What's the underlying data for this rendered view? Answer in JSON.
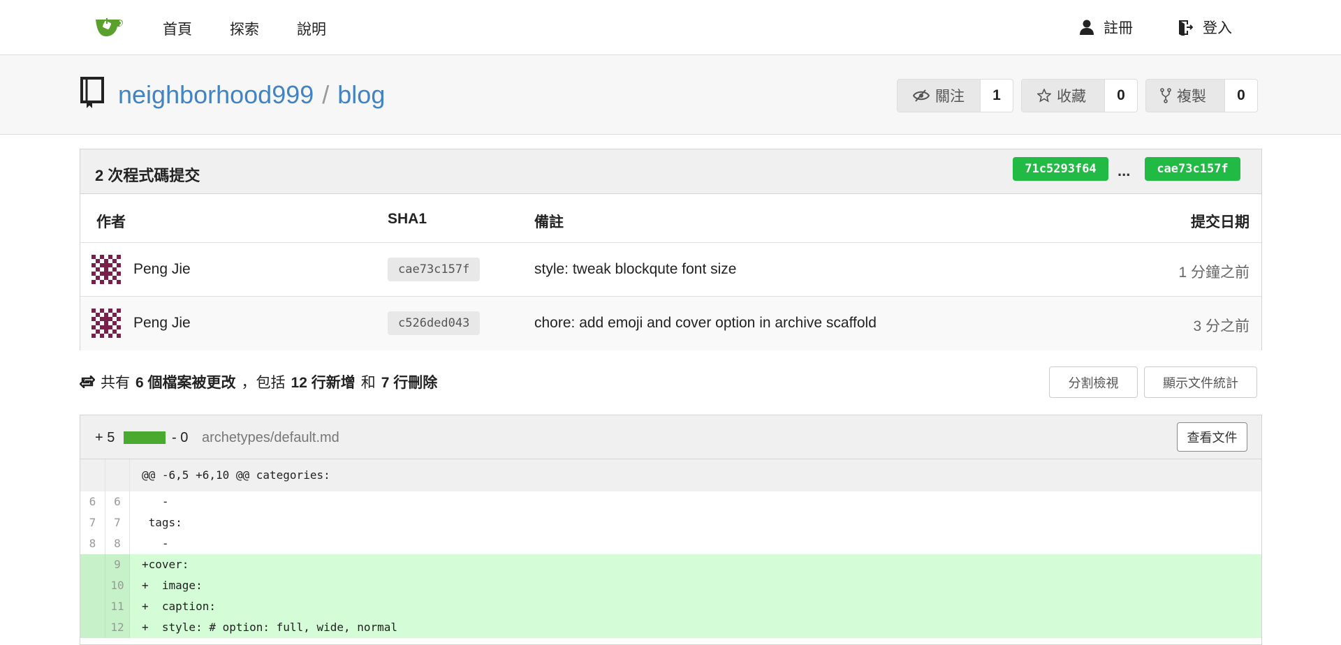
{
  "nav": {
    "links": [
      "首頁",
      "探索",
      "說明"
    ],
    "register": "註冊",
    "login": "登入"
  },
  "repo": {
    "owner": "neighborhood999",
    "separator": "/",
    "name": "blog",
    "watch": {
      "label": "關注",
      "count": "1"
    },
    "star": {
      "label": "收藏",
      "count": "0"
    },
    "fork": {
      "label": "複製",
      "count": "0"
    }
  },
  "commits": {
    "title": "2 次程式碼提交",
    "from_sha": "71c5293f64",
    "dots": "...",
    "to_sha": "cae73c157f",
    "headers": {
      "author": "作者",
      "sha": "SHA1",
      "message": "備註",
      "date": "提交日期"
    },
    "rows": [
      {
        "author": "Peng Jie",
        "sha": "cae73c157f",
        "message": "style: tweak blockqute font size",
        "date": "1 分鐘之前"
      },
      {
        "author": "Peng Jie",
        "sha": "c526ded043",
        "message": "chore: add emoji and cover option in archive scaffold",
        "date": "3 分之前"
      }
    ]
  },
  "stats": {
    "prefix": "共有",
    "files": "6 個檔案被更改",
    "comma": "，包括",
    "additions": "12 行新增",
    "and": "和",
    "deletions": "7 行刪除",
    "split_view": "分割檢視",
    "show_stats": "顯示文件統計"
  },
  "file": {
    "additions": "+ 5",
    "deletions": "- 0",
    "path": "archetypes/default.md",
    "view_file": "查看文件",
    "hunk_header": "@@ -6,5 +6,10 @@ categories:",
    "lines": [
      {
        "old": "6",
        "new": "6",
        "code": "   -",
        "type": "context"
      },
      {
        "old": "7",
        "new": "7",
        "code": " tags:",
        "type": "context"
      },
      {
        "old": "8",
        "new": "8",
        "code": "   -",
        "type": "context"
      },
      {
        "old": "",
        "new": "9",
        "code": "+cover:",
        "type": "added"
      },
      {
        "old": "",
        "new": "10",
        "code": "+  image:",
        "type": "added"
      },
      {
        "old": "",
        "new": "11",
        "code": "+  caption:",
        "type": "added"
      },
      {
        "old": "",
        "new": "12",
        "code": "+  style: # option: full, wide, normal",
        "type": "added"
      }
    ]
  },
  "colors": {
    "link": "#4183c4",
    "sha_pill": "#21ba45",
    "added_bg": "#d4fcd6",
    "add_bar": "#4aa92f"
  }
}
